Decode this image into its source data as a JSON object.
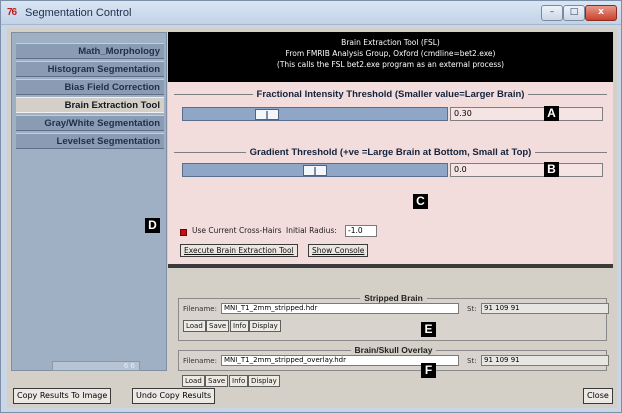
{
  "window": {
    "app_icon": "76",
    "title": "Segmentation Control",
    "minimize_glyph": "–",
    "maximize_glyph": "□",
    "close_glyph": "x"
  },
  "sidebar": {
    "items": [
      {
        "label": "Math_Morphology",
        "active": false
      },
      {
        "label": "Histogram Segmentation",
        "active": false
      },
      {
        "label": "Bias Field Correction",
        "active": false
      },
      {
        "label": "Brain Extraction Tool",
        "active": true
      },
      {
        "label": "Gray/White Segmentation",
        "active": false
      },
      {
        "label": "Levelset Segmentation",
        "active": false
      }
    ],
    "indicator_text": "6 6"
  },
  "header": {
    "line1": "Brain Extraction Tool (FSL)",
    "line2": "From FMRIB Analysis Group, Oxford (cmdline=bet2.exe)",
    "line3": "(This calls the FSL bet2.exe program as an external process)"
  },
  "fractional": {
    "title": "Fractional Intensity Threshold (Smaller value=Larger Brain)",
    "value": "0.30",
    "level": 0.3
  },
  "gradient": {
    "title": "Gradient Threshold (+ve =Large Brain at Bottom, Small at Top)",
    "value": "0.0",
    "level": 0.5
  },
  "crosshairs": {
    "label": "Use Current Cross-Hairs",
    "radius_label": "Initial Radius:",
    "radius_value": "-1.0"
  },
  "actions": {
    "execute": "Execute Brain Extraction Tool",
    "console": "Show Console"
  },
  "stripped": {
    "title": "Stripped Brain",
    "filename_label": "Filename:",
    "filename": "MNI_T1_2mm_stripped.hdr",
    "st_label": "St:",
    "st_value": "91 109 91",
    "buttons": [
      "Load",
      "Save",
      "Info",
      "Display"
    ]
  },
  "overlay": {
    "title": "Brain/Skull Overlay",
    "filename_label": "Filename:",
    "filename": "MNI_T1_2mm_stripped_overlay.hdr",
    "st_label": "St:",
    "st_value": "91 109 91",
    "buttons": [
      "Load",
      "Save",
      "Info",
      "Display"
    ]
  },
  "markers": [
    "A",
    "B",
    "C",
    "D",
    "E",
    "F"
  ],
  "bottom": {
    "copy": "Copy Results To Image",
    "undo": "Undo Copy Results",
    "close": "Close"
  },
  "colors": {
    "main_bg": "#f3dcdc",
    "header_bg": "#000000",
    "slider_fill": "#8fa6c6",
    "checkbox": "#c40f0f"
  }
}
